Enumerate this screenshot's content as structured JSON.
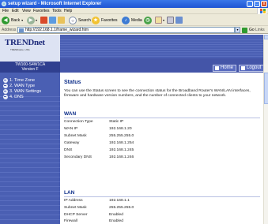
{
  "window": {
    "title": "setup wizard - Microsoft Internet Explorer",
    "min_label": "_",
    "max_label": "□",
    "close_label": "x"
  },
  "menu": [
    "File",
    "Edit",
    "View",
    "Favorites",
    "Tools",
    "Help"
  ],
  "toolbar": {
    "back_label": "Back",
    "search_label": "Search",
    "favorites_label": "Favorites",
    "media_label": "Media"
  },
  "address": {
    "label": "Address",
    "url": "http://192.168.1.1/frame_wizard.htm",
    "go_label": "Go",
    "links_label": "Links"
  },
  "router": {
    "logo": "TRENDnet",
    "logo_tagline": "TRENDware, USA",
    "model_line1": "TW100-S4W1CA",
    "model_line2": "Version F",
    "home_label": "Home",
    "logout_label": "Logout"
  },
  "sidebar": {
    "items": [
      {
        "label": "1. Time Zone"
      },
      {
        "label": "2. WAN Type"
      },
      {
        "label": "3. WAN Settings"
      },
      {
        "label": "4. DNS"
      }
    ]
  },
  "content": {
    "title": "Status",
    "description": "You can use the Status screen to see the connection status for the Broadband Router's WAN/LAN interfaces, firmware and hardware version numbers, and the number of connected clients to your network.",
    "wan": {
      "title": "WAN",
      "rows": [
        {
          "key": "Connection Type",
          "value": "Static IP"
        },
        {
          "key": "WAN IP",
          "value": "192.168.1.20"
        },
        {
          "key": "Subnet Mask",
          "value": "255.255.255.0"
        },
        {
          "key": "Gateway",
          "value": "192.168.1.254"
        },
        {
          "key": "DNS",
          "value": "192.168.1.245"
        },
        {
          "key": "Secondary DNS",
          "value": "192.168.1.246"
        }
      ]
    },
    "lan": {
      "title": "LAN",
      "rows": [
        {
          "key": "IP Address",
          "value": "192.168.1.1"
        },
        {
          "key": "Subnet Mask",
          "value": "255.255.255.0"
        },
        {
          "key": "DHCP Server",
          "value": "Enabled"
        },
        {
          "key": "Firewall",
          "value": "Enabled"
        }
      ]
    }
  },
  "colors": {
    "titlebar": "#1f55d3",
    "router_blue": "#4a5fb3",
    "heading_blue": "#0e2f8a"
  }
}
